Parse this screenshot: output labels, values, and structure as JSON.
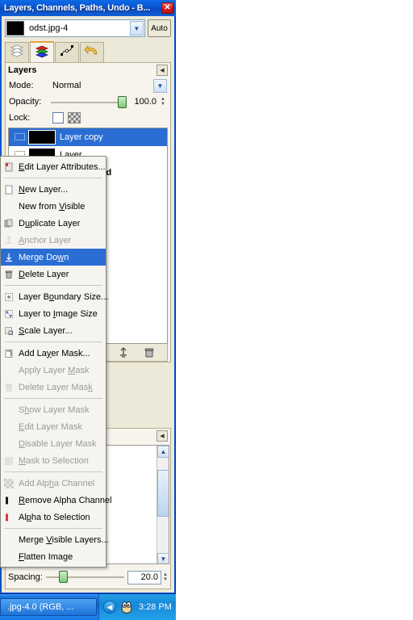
{
  "window": {
    "title": "Layers, Channels, Paths, Undo - B...",
    "close_label": "✕",
    "accent_blue": "#0a57d6",
    "highlight_blue": "#2a6ed4"
  },
  "image_select": {
    "value": "odst.jpg-4",
    "auto_label": "Auto",
    "dropdown_icon": "chevron-down-icon"
  },
  "tabs": [
    {
      "name": "layers-tab",
      "icon": "layers-stack-icon",
      "active": false
    },
    {
      "name": "channels-tab",
      "icon": "channels-color-stack-icon",
      "active": true
    },
    {
      "name": "paths-tab",
      "icon": "paths-node-icon",
      "active": false
    },
    {
      "name": "undo-tab",
      "icon": "undo-arrow-icon",
      "active": false
    }
  ],
  "layers_panel": {
    "title": "Layers",
    "menu_icon": "panel-menu-icon",
    "mode_label": "Mode:",
    "mode_value": "Normal",
    "opacity_label": "Opacity:",
    "opacity_value": "100.0",
    "lock_label": "Lock:",
    "lock_alpha_icon": "checkerboard-alpha-icon",
    "layers": [
      {
        "name": "Layer copy",
        "selected": true,
        "bold": false,
        "thumb": "black"
      },
      {
        "name": "Layer",
        "selected": false,
        "bold": false,
        "thumb": "black"
      },
      {
        "name": "Background",
        "selected": false,
        "bold": true,
        "thumb": "black"
      }
    ],
    "buttons": [
      {
        "name": "anchor-layer-button",
        "icon": "anchor-icon"
      },
      {
        "name": "delete-layer-button",
        "icon": "trash-icon"
      }
    ]
  },
  "brushes_panel": {
    "menu_icon": "panel-menu-icon",
    "spacing_label": "Spacing:",
    "spacing_value": "20.0",
    "scroll_up_icon": "chevron-up-icon",
    "scroll_down_icon": "chevron-down-icon"
  },
  "context_menu": {
    "items": [
      {
        "label": "Edit Layer Attributes...",
        "accel": "E",
        "state": "normal",
        "icon": "edit-attributes-icon"
      },
      {
        "separator": true
      },
      {
        "label": "New Layer...",
        "accel": "N",
        "state": "normal",
        "icon": "new-layer-icon"
      },
      {
        "label": "New from Visible",
        "accel": "V",
        "state": "normal",
        "icon": "none"
      },
      {
        "label": "Duplicate Layer",
        "accel": "u",
        "state": "normal",
        "icon": "duplicate-layer-icon"
      },
      {
        "label": "Anchor Layer",
        "accel": "A",
        "state": "disabled",
        "icon": "anchor-icon"
      },
      {
        "label": "Merge Down",
        "accel": "w",
        "state": "highlighted",
        "icon": "merge-down-icon"
      },
      {
        "label": "Delete Layer",
        "accel": "D",
        "state": "normal",
        "icon": "trash-icon"
      },
      {
        "separator": true
      },
      {
        "label": "Layer Boundary Size...",
        "accel": "o",
        "state": "normal",
        "icon": "layer-boundary-icon"
      },
      {
        "label": "Layer to Image Size",
        "accel": "I",
        "state": "normal",
        "icon": "layer-to-image-icon"
      },
      {
        "label": "Scale Layer...",
        "accel": "S",
        "state": "normal",
        "icon": "scale-layer-icon"
      },
      {
        "separator": true
      },
      {
        "label": "Add Layer Mask...",
        "accel": "y",
        "state": "normal",
        "icon": "add-layer-mask-icon"
      },
      {
        "label": "Apply Layer Mask",
        "accel": "M",
        "state": "disabled",
        "icon": "none"
      },
      {
        "label": "Delete Layer Mask",
        "accel": "k",
        "state": "disabled",
        "icon": "delete-mask-icon"
      },
      {
        "separator": true
      },
      {
        "label": "Show Layer Mask",
        "accel": "h",
        "state": "disabled",
        "icon": "none"
      },
      {
        "label": "Edit Layer Mask",
        "accel": "E",
        "state": "disabled",
        "icon": "none"
      },
      {
        "label": "Disable Layer Mask",
        "accel": "D",
        "state": "disabled",
        "icon": "none"
      },
      {
        "label": "Mask to Selection",
        "accel": "M",
        "state": "disabled",
        "icon": "mask-to-selection-icon"
      },
      {
        "separator": true
      },
      {
        "label": "Add Alpha Channel",
        "accel": "h",
        "state": "disabled",
        "icon": "alpha-checker-icon"
      },
      {
        "label": "Remove Alpha Channel",
        "accel": "R",
        "state": "normal",
        "icon": "remove-alpha-icon"
      },
      {
        "label": "Alpha to Selection",
        "accel": "p",
        "state": "normal",
        "icon": "alpha-to-selection-icon"
      },
      {
        "separator": true
      },
      {
        "label": "Merge Visible Layers...",
        "accel": "V",
        "state": "normal",
        "icon": "none"
      },
      {
        "label": "Flatten Image",
        "accel": "F",
        "state": "normal",
        "icon": "none"
      }
    ]
  },
  "taskbar": {
    "task_label": ".jpg-4.0 (RGB, ...",
    "tray_chevron_icon": "chevron-left-icon",
    "tray_app_icon": "gimp-wilber-icon",
    "clock": "3:28 PM"
  }
}
